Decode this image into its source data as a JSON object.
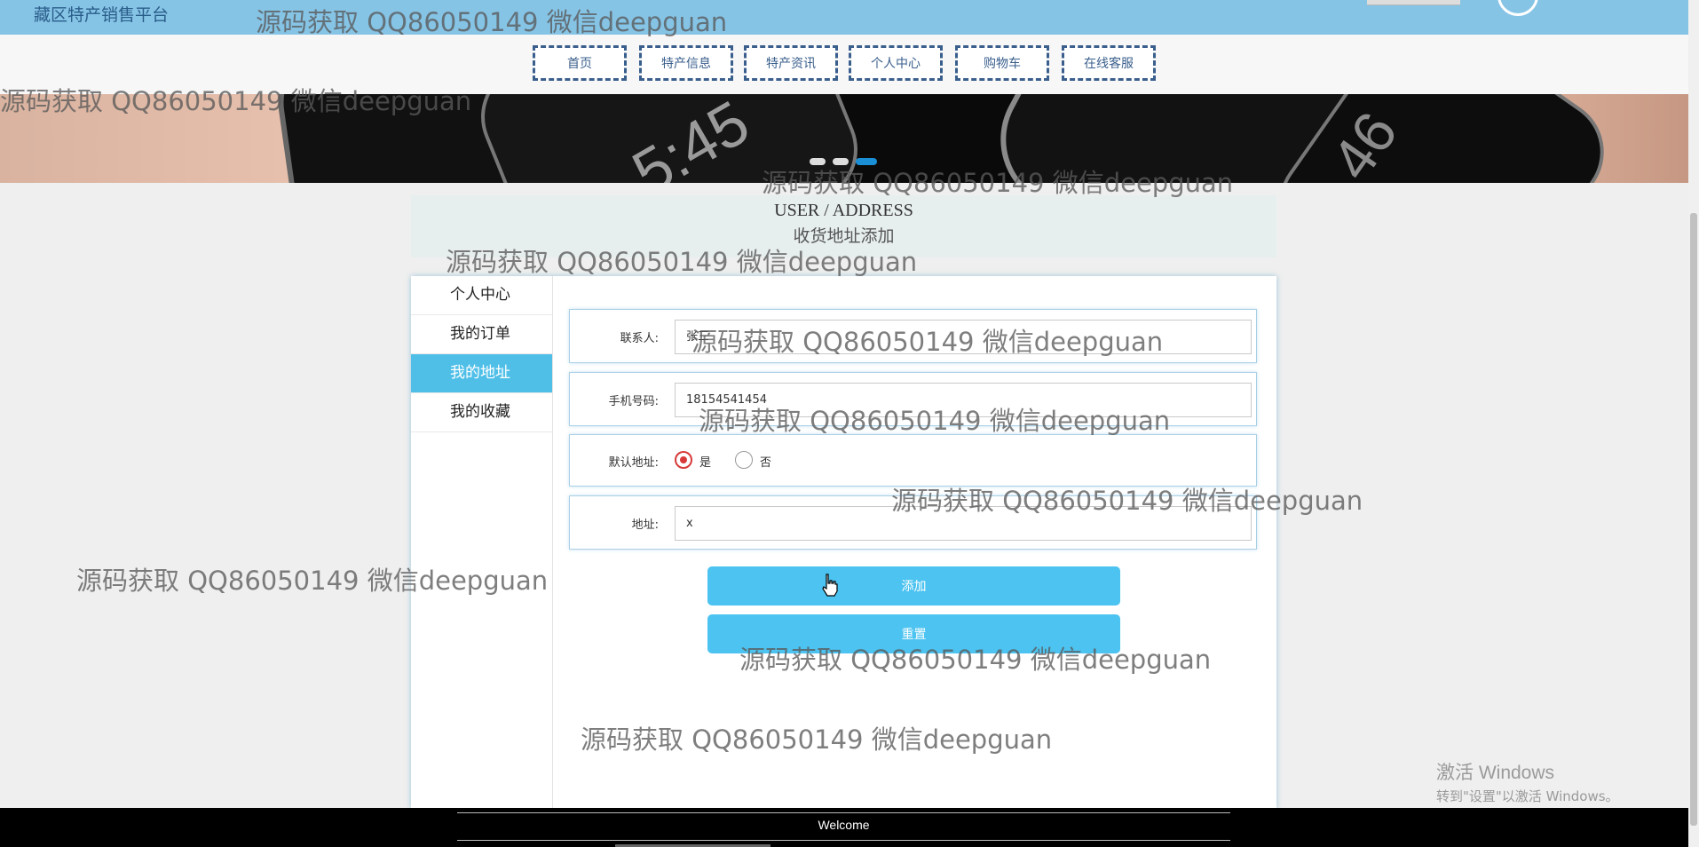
{
  "site": {
    "title": "藏区特产销售平台"
  },
  "nav": {
    "items": [
      "首页",
      "特产信息",
      "特产资讯",
      "个人中心",
      "购物车",
      "在线客服"
    ]
  },
  "section": {
    "title_en": "USER / ADDRESS",
    "title_cn": "收货地址添加"
  },
  "sidebar": {
    "items": [
      "个人中心",
      "我的订单",
      "我的地址",
      "我的收藏"
    ],
    "active_index": 2
  },
  "form": {
    "contact": {
      "label": "联系人:",
      "value": "张三"
    },
    "phone": {
      "label": "手机号码:",
      "value": "18154541454"
    },
    "default_address": {
      "label": "默认地址:",
      "options": [
        "是",
        "否"
      ],
      "selected": "是"
    },
    "address": {
      "label": "地址:",
      "value": "x"
    },
    "submit_label": "添加",
    "reset_label": "重置"
  },
  "footer": {
    "text": "Welcome"
  },
  "watermark": {
    "text": "源码获取 QQ86050149 微信deepguan"
  },
  "windows_activation": {
    "line1": "激活 Windows",
    "line2": "转到\"设置\"以激活 Windows。"
  },
  "colors": {
    "accent": "#4cc3f0",
    "topbar": "#86c4e6",
    "nav_border": "#3a5f8d",
    "radio_selected": "#d83a3a"
  }
}
